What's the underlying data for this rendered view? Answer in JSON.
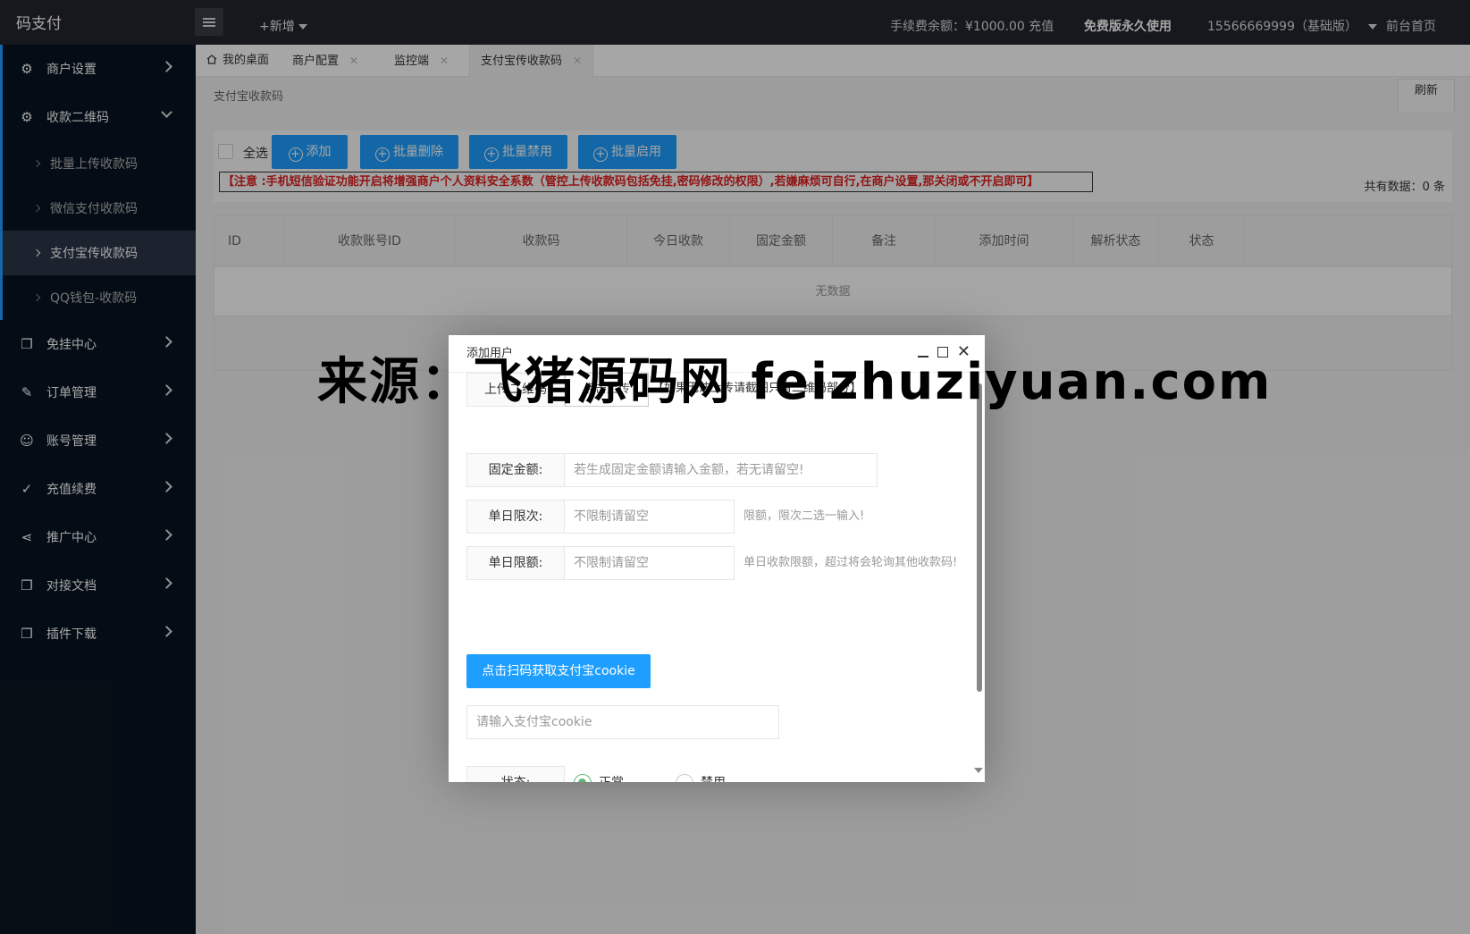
{
  "header": {
    "logo": "码支付",
    "add_new": "+新增",
    "balance": "手续费余额：¥1000.00 充值",
    "free_label": "免费版永久使用",
    "user": "15566669999（基础版）",
    "home": "前台首页"
  },
  "sidebar": {
    "items": [
      {
        "label": "商户设置",
        "icon": "gear-icon"
      },
      {
        "label": "收款二维码",
        "icon": "gear-icon"
      },
      {
        "label": "免挂中心",
        "icon": "cube-icon"
      },
      {
        "label": "订单管理",
        "icon": "edit-icon"
      },
      {
        "label": "账号管理",
        "icon": "user-icon"
      },
      {
        "label": "充值续费",
        "icon": "check-icon"
      },
      {
        "label": "推广中心",
        "icon": "share-icon"
      },
      {
        "label": "对接文档",
        "icon": "cube-icon"
      },
      {
        "label": "插件下载",
        "icon": "cube-icon"
      }
    ],
    "sub_items": [
      {
        "label": "批量上传收款码"
      },
      {
        "label": "微信支付收款码"
      },
      {
        "label": "支付宝传收款码"
      },
      {
        "label": "QQ钱包-收款码"
      }
    ]
  },
  "tabs": [
    {
      "label": "我的桌面"
    },
    {
      "label": "商户配置"
    },
    {
      "label": "监控端"
    },
    {
      "label": "支付宝传收款码"
    }
  ],
  "page": {
    "breadcrumb": "支付宝收款码",
    "refresh": "刷新",
    "select_all": "全选",
    "buttons": {
      "add": "添加",
      "batch_delete": "批量删除",
      "batch_disable": "批量禁用",
      "batch_enable": "批量启用"
    },
    "notice": "【注意 :手机短信验证功能开启将增强商户个人资料安全系数（管控上传收款码包括免挂,密码修改的权限）,若嫌麻烦可自行,在商户设置,那关闭或不开启即可】",
    "total": "共有数据：0 条",
    "columns": [
      "ID",
      "收款账号ID",
      "收款码",
      "今日收款",
      "固定金额",
      "备注",
      "添加时间",
      "解析状态",
      "状态"
    ],
    "empty": "无数据"
  },
  "modal": {
    "title": "添加用户",
    "upload_label": "上传二维码",
    "upload_button": "点击上传",
    "upload_hint": "【如果无法上传请截图只留二维码部分】",
    "fixed_amount_label": "固定金额:",
    "fixed_amount_placeholder": "若生成固定金额请输入金额，若无请留空!",
    "daily_count_label": "单日限次:",
    "daily_count_placeholder": "不限制请留空",
    "daily_count_hint": "限额，限次二选一输入!",
    "daily_amount_label": "单日限额:",
    "daily_amount_placeholder": "不限制请留空",
    "daily_amount_hint": "单日收款限额，超过将会轮询其他收款码!",
    "scan_button": "点击扫码获取支付宝cookie",
    "cookie_placeholder": "请输入支付宝cookie",
    "status_label": "状态:",
    "status_normal": "正常",
    "status_disabled": "禁用"
  },
  "watermark": "来源：飞猪源码网 feizhuziyuan.com",
  "colors": {
    "header_bg": "#23262e",
    "sidebar_bg": "#071421",
    "accent": "#1e9fff",
    "radio_on": "#5fb878",
    "notice": "#e02020"
  }
}
